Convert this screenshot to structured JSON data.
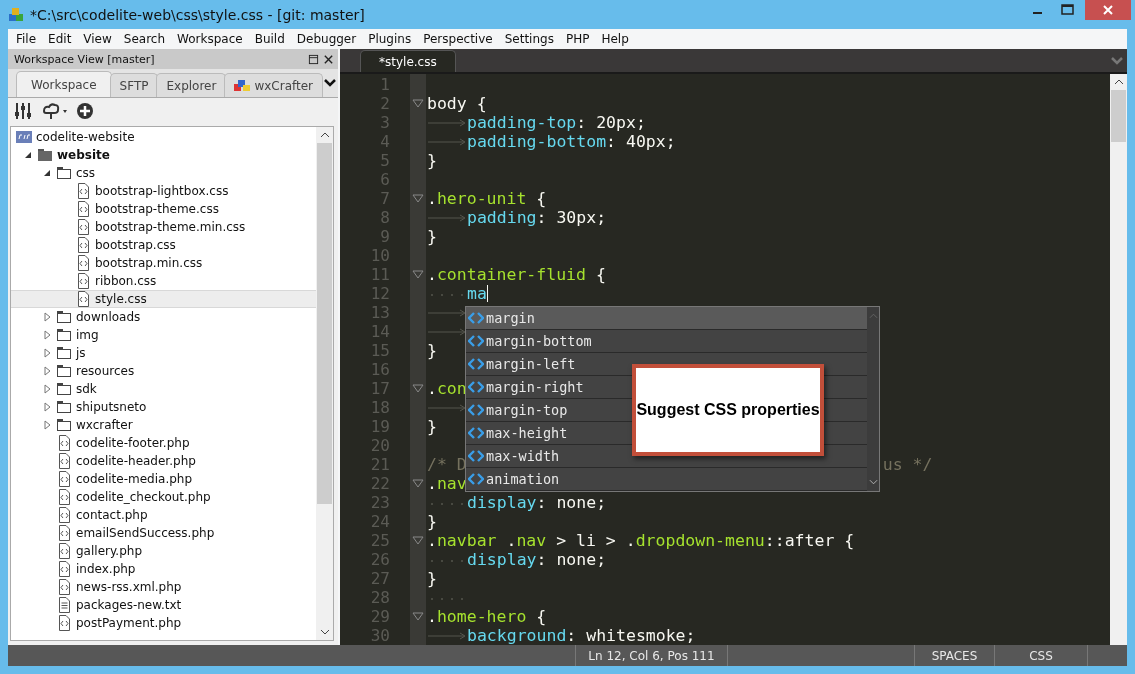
{
  "window": {
    "title": "*C:\\src\\codelite-web\\css\\style.css - [git: master]"
  },
  "menu": [
    "File",
    "Edit",
    "View",
    "Search",
    "Workspace",
    "Build",
    "Debugger",
    "Plugins",
    "Perspective",
    "Settings",
    "PHP",
    "Help"
  ],
  "workspace_view": {
    "title": "Workspace View [master]",
    "tabs": [
      {
        "label": "Workspace",
        "selected": true
      },
      {
        "label": "SFTP",
        "selected": false
      },
      {
        "label": "Explorer",
        "selected": false
      },
      {
        "label": "wxCrafter",
        "selected": false,
        "icon": true
      }
    ],
    "tree": [
      {
        "label": "codelite-website",
        "kind": "project",
        "selected": false,
        "children": [
          {
            "label": "website",
            "kind": "active-folder",
            "expanded": true,
            "selected": false,
            "children": [
              {
                "label": "css",
                "kind": "folder",
                "expanded": true,
                "selected": false,
                "children": [
                  {
                    "label": "bootstrap-lightbox.css",
                    "kind": "code-file",
                    "selected": false
                  },
                  {
                    "label": "bootstrap-theme.css",
                    "kind": "code-file",
                    "selected": false
                  },
                  {
                    "label": "bootstrap-theme.min.css",
                    "kind": "code-file",
                    "selected": false
                  },
                  {
                    "label": "bootstrap.css",
                    "kind": "code-file",
                    "selected": false
                  },
                  {
                    "label": "bootstrap.min.css",
                    "kind": "code-file",
                    "selected": false
                  },
                  {
                    "label": "ribbon.css",
                    "kind": "code-file",
                    "selected": false
                  },
                  {
                    "label": "style.css",
                    "kind": "code-file",
                    "selected": true
                  }
                ]
              },
              {
                "label": "downloads",
                "kind": "folder",
                "expanded": false,
                "selected": false
              },
              {
                "label": "img",
                "kind": "folder",
                "expanded": false,
                "selected": false
              },
              {
                "label": "js",
                "kind": "folder",
                "expanded": false,
                "selected": false
              },
              {
                "label": "resources",
                "kind": "folder",
                "expanded": false,
                "selected": false
              },
              {
                "label": "sdk",
                "kind": "folder",
                "expanded": false,
                "selected": false
              },
              {
                "label": "shiputsneto",
                "kind": "folder",
                "expanded": false,
                "selected": false
              },
              {
                "label": "wxcrafter",
                "kind": "folder",
                "expanded": false,
                "selected": false
              },
              {
                "label": "codelite-footer.php",
                "kind": "code-file",
                "selected": false
              },
              {
                "label": "codelite-header.php",
                "kind": "code-file",
                "selected": false
              },
              {
                "label": "codelite-media.php",
                "kind": "code-file",
                "selected": false
              },
              {
                "label": "codelite_checkout.php",
                "kind": "code-file",
                "selected": false
              },
              {
                "label": "contact.php",
                "kind": "code-file",
                "selected": false
              },
              {
                "label": "emailSendSuccess.php",
                "kind": "code-file",
                "selected": false
              },
              {
                "label": "gallery.php",
                "kind": "code-file",
                "selected": false
              },
              {
                "label": "index.php",
                "kind": "code-file",
                "selected": false
              },
              {
                "label": "news-rss.xml.php",
                "kind": "code-file",
                "selected": false
              },
              {
                "label": "packages-new.txt",
                "kind": "text-file",
                "selected": false
              },
              {
                "label": "postPayment.php",
                "kind": "code-file",
                "selected": false
              }
            ]
          }
        ]
      }
    ]
  },
  "editor": {
    "tabs": [
      {
        "label": "*style.css",
        "selected": true
      }
    ],
    "lines": [
      {
        "number": "1",
        "kind": "flush"
      },
      {
        "number": "2",
        "kind": "flush",
        "fold": true,
        "parts": [
          {
            "text": "body",
            "kind": "plain"
          },
          {
            "text": " {",
            "kind": "plain"
          }
        ]
      },
      {
        "number": "3",
        "kind": "tab",
        "parts": [
          {
            "text": "padding-top",
            "kind": "property"
          },
          {
            "text": ": 20px;",
            "kind": "plain"
          }
        ]
      },
      {
        "number": "4",
        "kind": "tab",
        "parts": [
          {
            "text": "padding-bottom",
            "kind": "property"
          },
          {
            "text": ": 40px;",
            "kind": "plain"
          }
        ]
      },
      {
        "number": "5",
        "kind": "flush",
        "parts": [
          {
            "text": "}",
            "kind": "plain"
          }
        ]
      },
      {
        "number": "6",
        "kind": "flush"
      },
      {
        "number": "7",
        "kind": "flush",
        "fold": true,
        "parts": [
          {
            "text": ".",
            "kind": "plain"
          },
          {
            "text": "hero-unit",
            "kind": "selector"
          },
          {
            "text": " {",
            "kind": "plain"
          }
        ]
      },
      {
        "number": "8",
        "kind": "tab",
        "parts": [
          {
            "text": "padding",
            "kind": "property"
          },
          {
            "text": ": 30px;",
            "kind": "plain"
          }
        ]
      },
      {
        "number": "9",
        "kind": "flush",
        "parts": [
          {
            "text": "}",
            "kind": "plain"
          }
        ]
      },
      {
        "number": "10",
        "kind": "flush"
      },
      {
        "number": "11",
        "kind": "flush",
        "fold": true,
        "parts": [
          {
            "text": ".",
            "kind": "plain"
          },
          {
            "text": "container-fluid",
            "kind": "selector"
          },
          {
            "text": " {",
            "kind": "plain"
          }
        ]
      },
      {
        "number": "12",
        "kind": "spaces",
        "caret": true,
        "parts": [
          {
            "text": "ma",
            "kind": "property"
          }
        ]
      },
      {
        "number": "13",
        "kind": "tab"
      },
      {
        "number": "14",
        "kind": "tab"
      },
      {
        "number": "15",
        "kind": "flush",
        "parts": [
          {
            "text": "}",
            "kind": "plain"
          }
        ]
      },
      {
        "number": "16",
        "kind": "flush"
      },
      {
        "number": "17",
        "kind": "flush",
        "fold": true,
        "parts": [
          {
            "text": ".",
            "kind": "plain"
          },
          {
            "text": "con",
            "kind": "selector"
          }
        ]
      },
      {
        "number": "18",
        "kind": "tab"
      },
      {
        "number": "19",
        "kind": "flush",
        "parts": [
          {
            "text": "}",
            "kind": "plain"
          }
        ]
      },
      {
        "number": "20",
        "kind": "flush"
      },
      {
        "number": "21",
        "kind": "flush",
        "parts": [
          {
            "text": "/* D",
            "kind": "comment"
          },
          {
            "text": "us */",
            "kind": "comment-tail"
          }
        ]
      },
      {
        "number": "22",
        "kind": "flush",
        "fold": true,
        "parts": [
          {
            "text": ".",
            "kind": "plain"
          },
          {
            "text": "nav",
            "kind": "selector"
          }
        ]
      },
      {
        "number": "23",
        "kind": "spaces",
        "parts": [
          {
            "text": "display",
            "kind": "property"
          },
          {
            "text": ": none;",
            "kind": "plain"
          }
        ]
      },
      {
        "number": "24",
        "kind": "flush",
        "parts": [
          {
            "text": "}",
            "kind": "plain"
          }
        ]
      },
      {
        "number": "25",
        "kind": "flush",
        "fold": true,
        "parts": [
          {
            "text": ".",
            "kind": "plain"
          },
          {
            "text": "navbar",
            "kind": "selector"
          },
          {
            "text": " .",
            "kind": "plain"
          },
          {
            "text": "nav",
            "kind": "selector"
          },
          {
            "text": " > li > .",
            "kind": "plain"
          },
          {
            "text": "dropdown-menu",
            "kind": "selector"
          },
          {
            "text": "::after {",
            "kind": "plain"
          }
        ]
      },
      {
        "number": "26",
        "kind": "spaces",
        "parts": [
          {
            "text": "display",
            "kind": "property"
          },
          {
            "text": ": none;",
            "kind": "plain"
          }
        ]
      },
      {
        "number": "27",
        "kind": "flush",
        "parts": [
          {
            "text": "}",
            "kind": "plain"
          }
        ]
      },
      {
        "number": "28",
        "kind": "spaces"
      },
      {
        "number": "29",
        "kind": "flush",
        "fold": true,
        "parts": [
          {
            "text": ".",
            "kind": "plain"
          },
          {
            "text": "home-hero",
            "kind": "selector"
          },
          {
            "text": " {",
            "kind": "plain"
          }
        ]
      },
      {
        "number": "30",
        "kind": "tab",
        "parts": [
          {
            "text": "background",
            "kind": "property"
          },
          {
            "text": ": whitesmoke;",
            "kind": "plain"
          }
        ]
      }
    ],
    "completion": [
      {
        "label": "margin",
        "selected": true
      },
      {
        "label": "margin-bottom",
        "selected": false
      },
      {
        "label": "margin-left",
        "selected": false
      },
      {
        "label": "margin-right",
        "selected": false
      },
      {
        "label": "margin-top",
        "selected": false
      },
      {
        "label": "max-height",
        "selected": false
      },
      {
        "label": "max-width",
        "selected": false
      },
      {
        "label": "animation",
        "selected": false
      }
    ],
    "callout": "Suggest CSS properties"
  },
  "status_bar": {
    "position": "Ln 12, Col 6, Pos 111",
    "indentation": "SPACES",
    "language": "CSS"
  }
}
